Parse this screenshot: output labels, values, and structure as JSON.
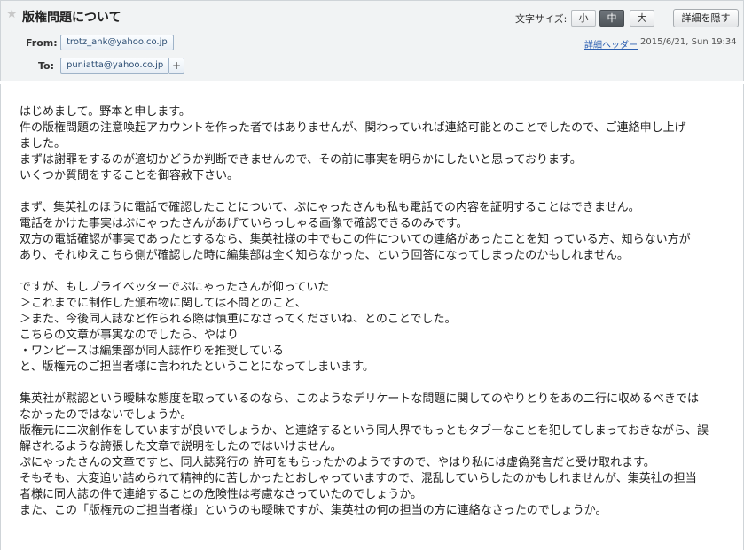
{
  "header": {
    "subject": "版権問題について",
    "font_size_label": "文字サイズ:",
    "font_sizes": [
      "小",
      "中",
      "大"
    ],
    "font_size_selected": "中",
    "hide_details_label": "詳細を隠す",
    "from_label": "From:",
    "from_address": "trotz_ank@yahoo.co.jp",
    "to_label": "To:",
    "to_address": "puniatta@yahoo.co.jp",
    "add_symbol": "+",
    "detail_header_link": "詳細ヘッダー",
    "date": "2015/6/21, Sun 19:34"
  },
  "body": {
    "lines": [
      "はじめまして。野本と申します。",
      "件の版権問題の注意喚起アカウントを作った者ではありませんが、関わっていれば連絡可能とのことでしたので、ご連絡申し上げ",
      "ました。",
      "まずは謝罪をするのが適切かどうか判断できませんので、その前に事実を明らかにしたいと思っております。",
      "いくつか質問をすることを御容赦下さい。",
      "",
      "まず、集英社のほうに電話で確認したことについて、ぷにゃったさんも私も電話での内容を証明することはできません。",
      "電話をかけた事実はぷにゃったさんがあげていらっしゃる画像で確認できるのみです。",
      "双方の電話確認が事実であったとするなら、集英社様の中でもこの件についての連絡があったことを知 っている方、知らない方が",
      "あり、それゆえこちら側が確認した時に編集部は全く知らなかった、という回答になってしまったのかもしれません。",
      "",
      "ですが、もしプライベッターでぷにゃったさんが仰っていた",
      "＞これまでに制作した頒布物に関しては不問とのこと、",
      "＞また、今後同人誌など作られる際は慎重になさってくださいね、とのことでした。",
      "こちらの文章が事実なのでしたら、やはり",
      "・ワンピースは編集部が同人誌作りを推奨している",
      "と、版権元のご担当者様に言われたということになってしまいます。",
      "",
      "集英社が黙認という曖昧な態度を取っているのなら、このようなデリケートな問題に関してのやりとりをあの二行に収めるべきでは",
      "なかったのではないでしょうか。",
      "版権元に二次創作をしていますが良いでしょうか、と連絡するという同人界でもっともタブーなことを犯してしまっておきながら、誤",
      "解されるような誇張した文章で説明をしたのではいけません。",
      "ぷにゃったさんの文章ですと、同人誌発行の 許可をもらったかのようですので、やはり私には虚偽発言だと受け取れます。",
      "そもそも、大変追い詰められて精神的に苦しかったとおしゃっていますので、混乱していらしたのかもしれませんが、集英社の担当",
      "者様に同人誌の件で連絡することの危険性は考慮なさっていたのでしょうか。",
      "また、この「版権元のご担当者様」というのも曖昧ですが、集英社の何の担当の方に連絡なさったのでしょうか。"
    ]
  }
}
